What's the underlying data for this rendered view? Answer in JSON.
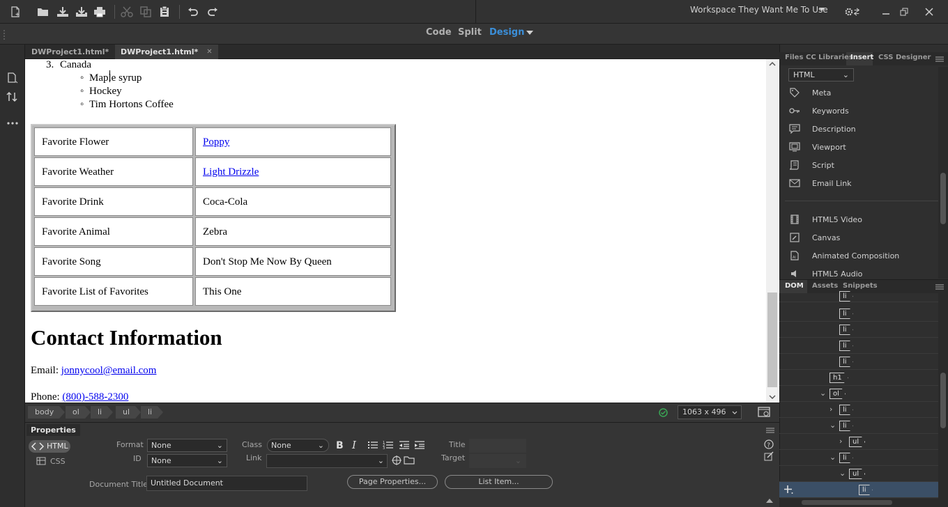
{
  "workspace": {
    "name": "Workspace They Want Me To Use"
  },
  "view_modes": {
    "code": "Code",
    "split": "Split",
    "design": "Design"
  },
  "doc_tabs": [
    {
      "label": "DWProject1.html*",
      "active": false
    },
    {
      "label": "DWProject1.html*",
      "active": true
    }
  ],
  "document": {
    "list_item_number": "3.",
    "list_item": "Canada",
    "sub_items": [
      "Maple syrup",
      "Hockey",
      "Tim Hortons Coffee"
    ],
    "table": [
      {
        "label": "Favorite Flower",
        "value": "Poppy",
        "link": true
      },
      {
        "label": "Favorite Weather",
        "value": "Light Drizzle",
        "link": true
      },
      {
        "label": "Favorite Drink",
        "value": "Coca-Cola",
        "link": false
      },
      {
        "label": "Favorite Animal",
        "value": "Zebra",
        "link": false
      },
      {
        "label": "Favorite Song",
        "value": "Don't Stop Me Now By Queen",
        "link": false
      },
      {
        "label": "Favorite List of Favorites",
        "value": "This One",
        "link": false
      }
    ],
    "contact_heading": "Contact Information",
    "email_label": "Email: ",
    "email": "jonnycool@email.com",
    "phone_label": "Phone: ",
    "phone": "(800)-588-2300"
  },
  "breadcrumbs": [
    "body",
    "ol",
    "li",
    "ul",
    "li"
  ],
  "status": {
    "window_size": "1063 x 496",
    "valid_color": "#3aa655"
  },
  "properties": {
    "title": "Properties",
    "html_label": "HTML",
    "css_label": "CSS",
    "format_label": "Format",
    "format_value": "None",
    "id_label": "ID",
    "id_value": "None",
    "class_label": "Class",
    "class_value": "None",
    "link_label": "Link",
    "link_value": "",
    "title_label": "Title",
    "target_label": "Target",
    "doc_title_label": "Document Title",
    "doc_title_value": "Untitled Document",
    "page_properties": "Page Properties...",
    "list_item": "List Item..."
  },
  "panel_tabs": [
    "Files",
    "CC Libraries",
    "Insert",
    "CSS Designer"
  ],
  "insert": {
    "category": "HTML",
    "items": [
      {
        "label": "Meta",
        "icon": "tag-icon"
      },
      {
        "label": "Keywords",
        "icon": "key-icon"
      },
      {
        "label": "Description",
        "icon": "description-icon"
      },
      {
        "label": "Viewport",
        "icon": "viewport-icon"
      },
      {
        "label": "Script",
        "icon": "script-icon"
      },
      {
        "label": "Email Link",
        "icon": "envelope-icon"
      },
      {
        "label": "HTML5 Video",
        "icon": "film-icon"
      },
      {
        "label": "Canvas",
        "icon": "canvas-icon"
      },
      {
        "label": "Animated Composition",
        "icon": "animation-icon"
      },
      {
        "label": "HTML5 Audio",
        "icon": "speaker-icon"
      }
    ]
  },
  "bottom_tabs": [
    "DOM",
    "Assets",
    "Snippets"
  ],
  "dom_tree": [
    {
      "tag": "li"
    },
    {
      "tag": "li"
    },
    {
      "tag": "li"
    },
    {
      "tag": "li"
    },
    {
      "tag": "li"
    },
    {
      "tag": "h1"
    },
    {
      "tag": "ol"
    },
    {
      "tag": "li"
    },
    {
      "tag": "li"
    },
    {
      "tag": "ul"
    },
    {
      "tag": "li"
    },
    {
      "tag": "ul"
    },
    {
      "tag": "li"
    }
  ],
  "colors": {
    "accent": "#3b8fd9",
    "link": "#0000ee",
    "selected_row": "#3b4f66"
  }
}
